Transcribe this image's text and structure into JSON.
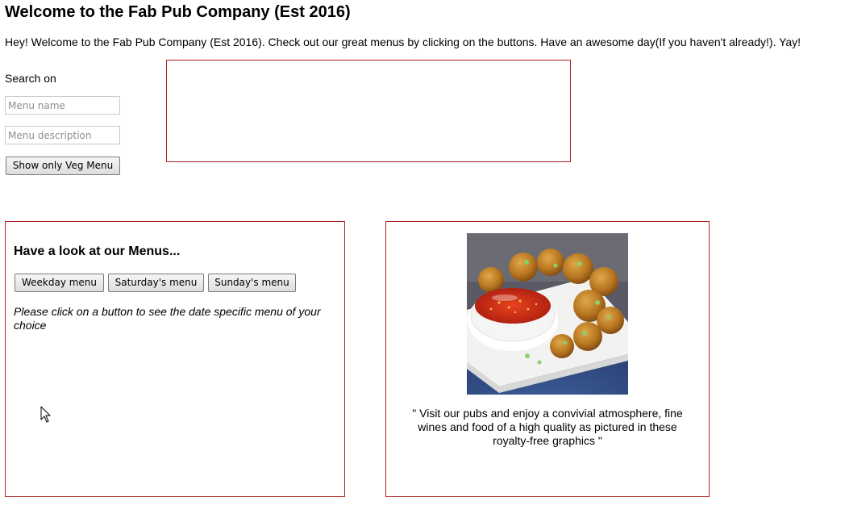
{
  "page": {
    "title": "Welcome to the Fab Pub Company (Est 2016)",
    "intro": "Hey! Welcome to the Fab Pub Company (Est 2016). Check out our great menus by clicking on the buttons. Have an awesome day(If you haven't already!). Yay!"
  },
  "search": {
    "label": "Search on",
    "name_placeholder": "Menu name",
    "name_value": "",
    "description_placeholder": "Menu description",
    "description_value": "",
    "veg_button_label": "Show only Veg Menu"
  },
  "results": {
    "items": []
  },
  "menus": {
    "heading": "Have a look at our Menus...",
    "buttons": [
      {
        "label": "Weekday menu"
      },
      {
        "label": "Saturday's menu"
      },
      {
        "label": "Sunday's menu"
      }
    ],
    "note": "Please click on a button to see the date specific menu of your choice"
  },
  "promo": {
    "image": "food-photo-pakoras-with-chili-dip",
    "quote": "\" Visit our pubs and enjoy a convivial atmosphere, fine wines and food of a high quality as pictured in these royalty-free graphics \""
  },
  "colors": {
    "panel_border": "#b22222"
  },
  "cursor": {
    "icon": "mouse-pointer-icon"
  }
}
